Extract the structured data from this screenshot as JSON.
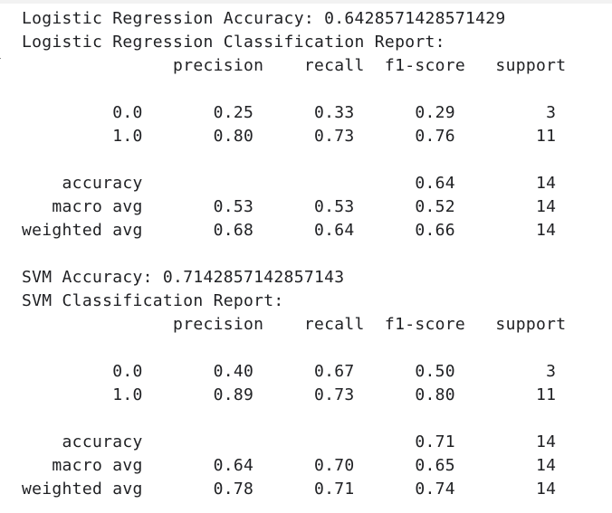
{
  "output": {
    "lines": [
      "Logistic Regression Accuracy: 0.6428571428571429",
      "Logistic Regression Classification Report:",
      "               precision    recall  f1-score   support",
      "",
      "         0.0       0.25      0.33      0.29         3",
      "         1.0       0.80      0.73      0.76        11",
      "",
      "    accuracy                           0.64        14",
      "   macro avg       0.53      0.53      0.52        14",
      "weighted avg       0.68      0.64      0.66        14",
      "",
      "SVM Accuracy: 0.7142857142857143",
      "SVM Classification Report:",
      "               precision    recall  f1-score   support",
      "",
      "         0.0       0.40      0.67      0.50         3",
      "         1.0       0.89      0.73      0.80        11",
      "",
      "    accuracy                           0.71        14",
      "   macro avg       0.64      0.70      0.65        14",
      "weighted avg       0.78      0.71      0.74        14"
    ]
  }
}
